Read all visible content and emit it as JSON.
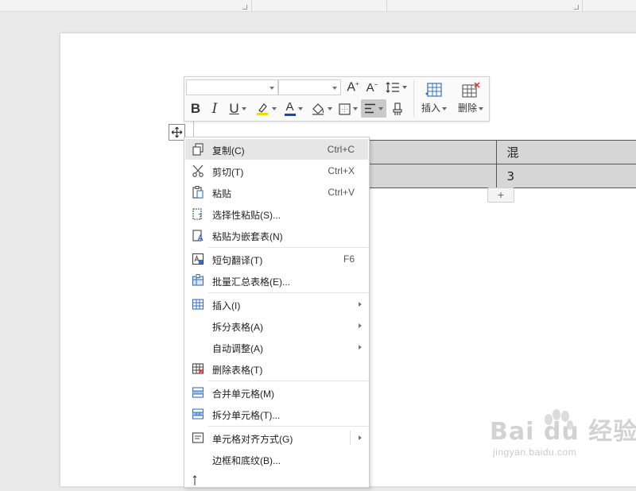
{
  "toolbar": {
    "font_name": "",
    "font_size": "",
    "insert_label": "插入",
    "delete_label": "删除",
    "bold_glyph": "B",
    "italic_glyph": "I",
    "underline_glyph": "U",
    "font_color_glyph": "A",
    "grow_glyph": "A",
    "shrink_glyph": "A"
  },
  "table": {
    "rows": [
      [
        "",
        "混"
      ],
      [
        "",
        "3"
      ]
    ],
    "add_row_label": "+"
  },
  "context_menu": {
    "items": [
      {
        "label": "复制(C)",
        "shortcut": "Ctrl+C",
        "icon": "copy-icon"
      },
      {
        "label": "剪切(T)",
        "shortcut": "Ctrl+X",
        "icon": "scissors-icon"
      },
      {
        "label": "粘贴",
        "shortcut": "Ctrl+V",
        "icon": "paste-icon"
      },
      {
        "label": "选择性粘贴(S)...",
        "shortcut": "",
        "icon": "paste-special-icon"
      },
      {
        "label": "粘贴为嵌套表(N)",
        "shortcut": "",
        "icon": "paste-nested-icon"
      },
      {
        "label": "短句翻译(T)",
        "shortcut": "F6",
        "icon": "translate-icon"
      },
      {
        "label": "批量汇总表格(E)...",
        "shortcut": "",
        "icon": "batch-table-icon"
      },
      {
        "label": "插入(I)",
        "shortcut": "",
        "icon": "table-insert-icon"
      },
      {
        "label": "拆分表格(A)",
        "shortcut": "",
        "icon": ""
      },
      {
        "label": "自动调整(A)",
        "shortcut": "",
        "icon": ""
      },
      {
        "label": "删除表格(T)",
        "shortcut": "",
        "icon": "table-delete-icon"
      },
      {
        "label": "合并单元格(M)",
        "shortcut": "",
        "icon": "merge-cells-icon"
      },
      {
        "label": "拆分单元格(T)...",
        "shortcut": "",
        "icon": "split-cells-icon"
      },
      {
        "label": "单元格对齐方式(G)",
        "shortcut": "",
        "icon": "cell-align-icon"
      },
      {
        "label": "边框和底纹(B)...",
        "shortcut": "",
        "icon": ""
      }
    ]
  },
  "watermark": {
    "brand": "Bai du 经验",
    "url": "jingyan.baidu.com"
  },
  "colors": {
    "highlight_yellow": "#f5d800",
    "font_color_blue": "#1f3fbf",
    "delete_red": "#e03030",
    "cell_fill": "#d6d6d6"
  }
}
